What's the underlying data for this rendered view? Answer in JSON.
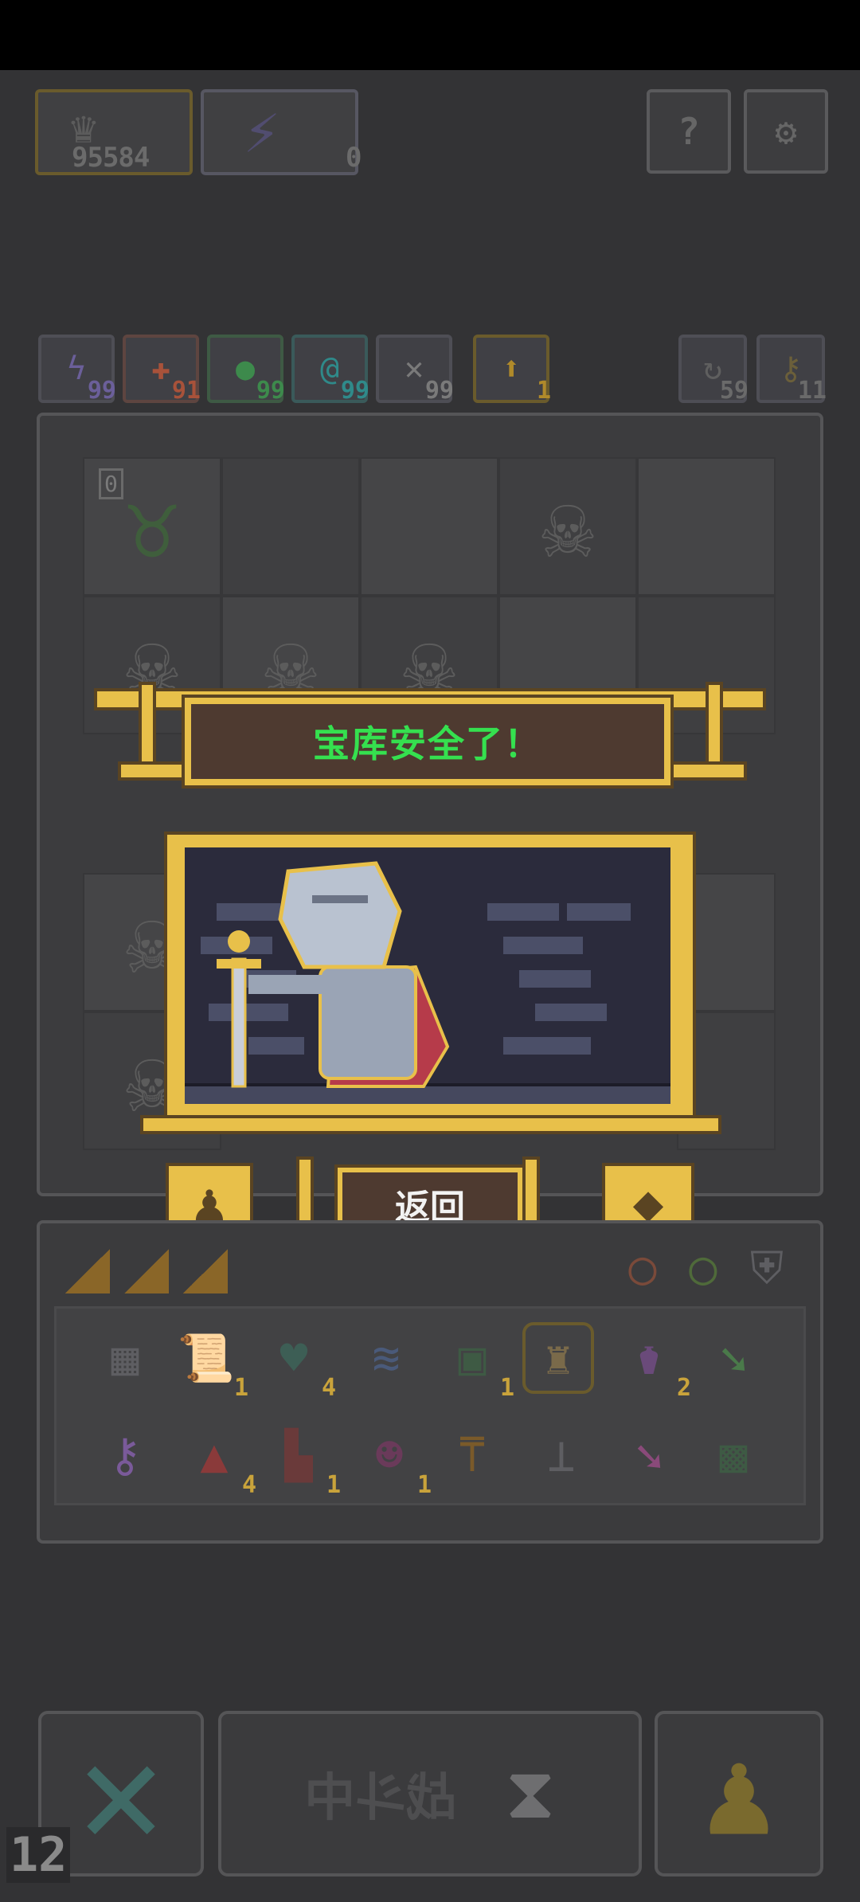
{
  "resources": {
    "coins": "95584",
    "energy": "0"
  },
  "abilities": [
    {
      "icon": "lightning-icon",
      "color": "#6b5f9a",
      "count": "99"
    },
    {
      "icon": "fire-icon",
      "color": "#a8523a",
      "count": "91"
    },
    {
      "icon": "poison-icon",
      "color": "#3d8a4c",
      "count": "99"
    },
    {
      "icon": "vortex-icon",
      "color": "#2f8a8a",
      "count": "99"
    },
    {
      "icon": "sword-icon",
      "color": "#7a7a7a",
      "count": "99"
    },
    {
      "icon": "arrow-up-icon",
      "color": "#b08a2a",
      "count": "1"
    }
  ],
  "counters": [
    {
      "icon": "cycle-icon",
      "count": "59"
    },
    {
      "icon": "key-icon",
      "count": "11"
    }
  ],
  "board": {
    "monster_level": "0"
  },
  "banner": {
    "title": "宝库安全了！"
  },
  "actions": {
    "return_label": "返回"
  },
  "inventory": {
    "row1_counts": [
      "",
      "1",
      "4",
      "",
      "1",
      "",
      "2",
      ""
    ],
    "row2_counts": [
      "",
      "4",
      "1",
      "1",
      "",
      "",
      "",
      ""
    ]
  },
  "bottom": {
    "status": "战斗中",
    "turn": "12"
  },
  "colors": {
    "gold": "#e8c04a",
    "banner_text": "#35e04f",
    "panel_brown": "#4e3a30"
  }
}
